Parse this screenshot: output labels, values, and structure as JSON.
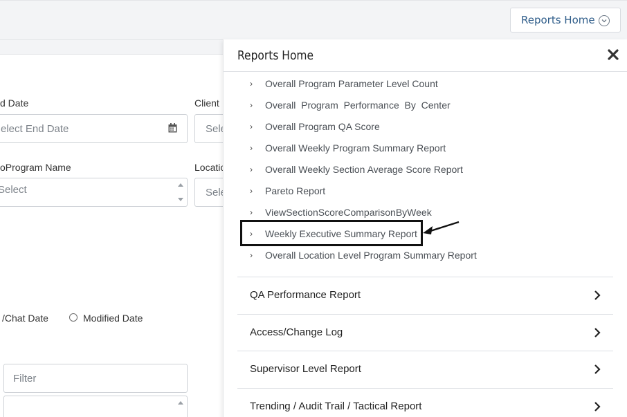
{
  "topbar": {
    "reports_home_label": "Reports Home"
  },
  "form": {
    "end_date_label": "d Date",
    "end_date_placeholder": "elect End Date",
    "client_label": "Client",
    "client_placeholder": "Sele",
    "program_label": "oProgram Name",
    "program_placeholder": "Select",
    "location_label": "Locatio",
    "location_placeholder": "Sele",
    "radio_chat_label": "/Chat Date",
    "radio_modified_label": "Modified Date",
    "filter_placeholder": "Filter"
  },
  "panel": {
    "title": "Reports Home",
    "sub_items": [
      "Overall Program Parameter Level Count",
      "Overall  Program  Performance  By  Center",
      "Overall Program QA Score",
      "Overall Weekly Program Summary Report",
      "Overall Weekly Section Average Score Report",
      "Pareto Report",
      "ViewSectionScoreComparisonByWeek",
      "Weekly Executive Summary Report",
      "Overall Location Level Program Summary Report"
    ],
    "sections": [
      "QA Performance Report",
      "Access/Change Log",
      "Supervisor Level Report",
      "Trending / Audit Trail / Tactical Report"
    ]
  },
  "colors": {
    "link_blue": "#2f5d8a",
    "highlight_border": "#111111"
  }
}
